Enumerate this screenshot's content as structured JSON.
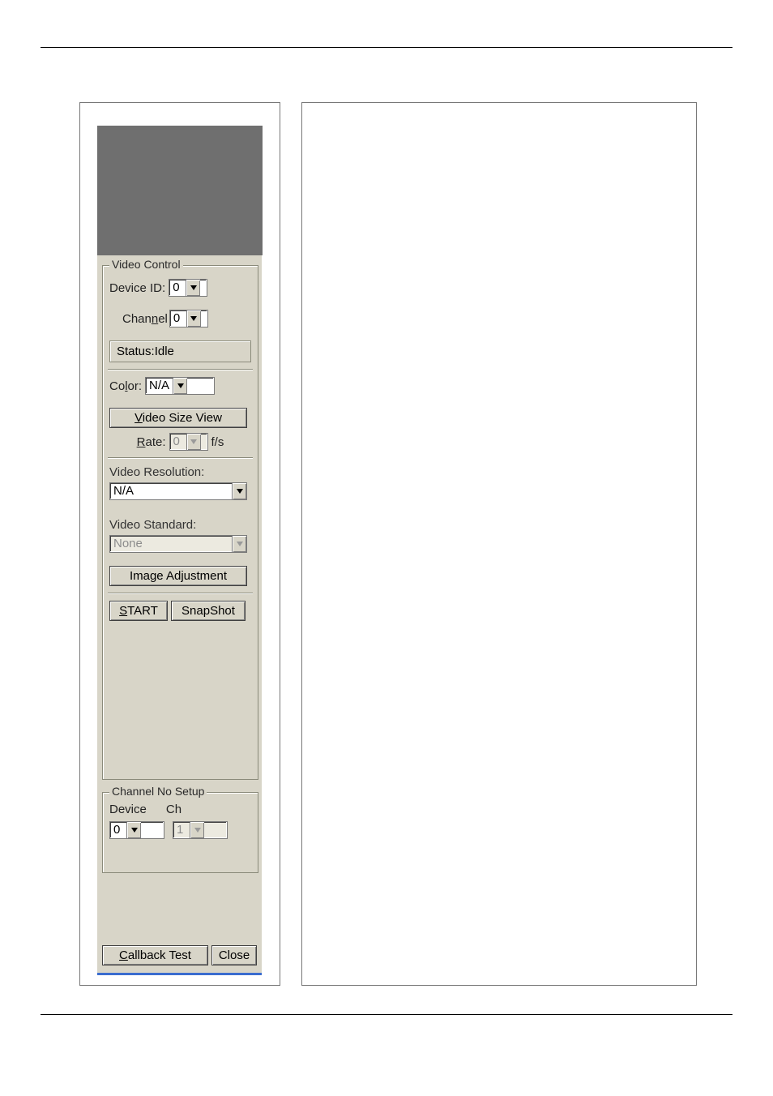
{
  "videoControl": {
    "legend": "Video Control",
    "deviceId": {
      "label": "Device ID:",
      "value": "0"
    },
    "channel": {
      "label_pre": "Chan",
      "label_mnem": "n",
      "label_post": "el",
      "value": "0"
    },
    "status": {
      "label": "Status:",
      "value": "Idle"
    },
    "color": {
      "label_pre": "Co",
      "label_mnem": "l",
      "label_post": "or:",
      "value": "N/A"
    },
    "videoSizeView": {
      "label_pre": "",
      "label_mnem": "V",
      "label_post": "ideo Size View"
    },
    "rate": {
      "label_pre": "",
      "label_mnem": "R",
      "label_post": "ate:",
      "value": "0",
      "unit": "f/s"
    },
    "videoResolution": {
      "label": "Video Resolution:",
      "value": "N/A"
    },
    "videoStandard": {
      "label": "Video Standard:",
      "value": "None"
    },
    "imageAdjustment": {
      "label": "Image Adjustment"
    },
    "start": {
      "label_mnem": "S",
      "label_post": "TART"
    },
    "snapshot": {
      "label": "SnapShot"
    }
  },
  "channelSetup": {
    "legend": "Channel No Setup",
    "deviceLabel": "Device",
    "chLabel": "Ch",
    "deviceValue": "0",
    "chValue": "1"
  },
  "bottom": {
    "callback": {
      "label_mnem": "C",
      "label_post": "allback Test"
    },
    "close": {
      "label": "Close"
    }
  }
}
